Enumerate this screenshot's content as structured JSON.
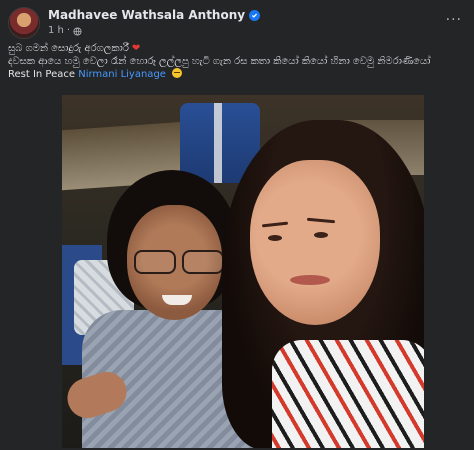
{
  "post": {
    "author": "Madhavee Wathsala Anthony",
    "time": "1 h",
    "separator": "·",
    "more_label": "···",
    "lines": [
      "සුබ ගමන් සොදුරු අරගලකාරී",
      "දවසක ආයෙ හමු වෙලා රෑන් හොරූ ලල්ලපු හැටි ගැන රස කතා කියෝ කියෝ හිනා වෙමු නිමරාණියෝ",
      "Rest In Peace"
    ],
    "mention": "Nirmani Liyanage",
    "heart_glyph": "❤"
  },
  "colors": {
    "background": "#242526",
    "text": "#e4e6eb",
    "secondary_text": "#b0b3b8",
    "link": "#4599ff",
    "verified": "#1877f2"
  },
  "icons": {
    "verified": "verified-badge-icon",
    "privacy": "globe-icon",
    "emoji": "sad-face-emoji"
  }
}
